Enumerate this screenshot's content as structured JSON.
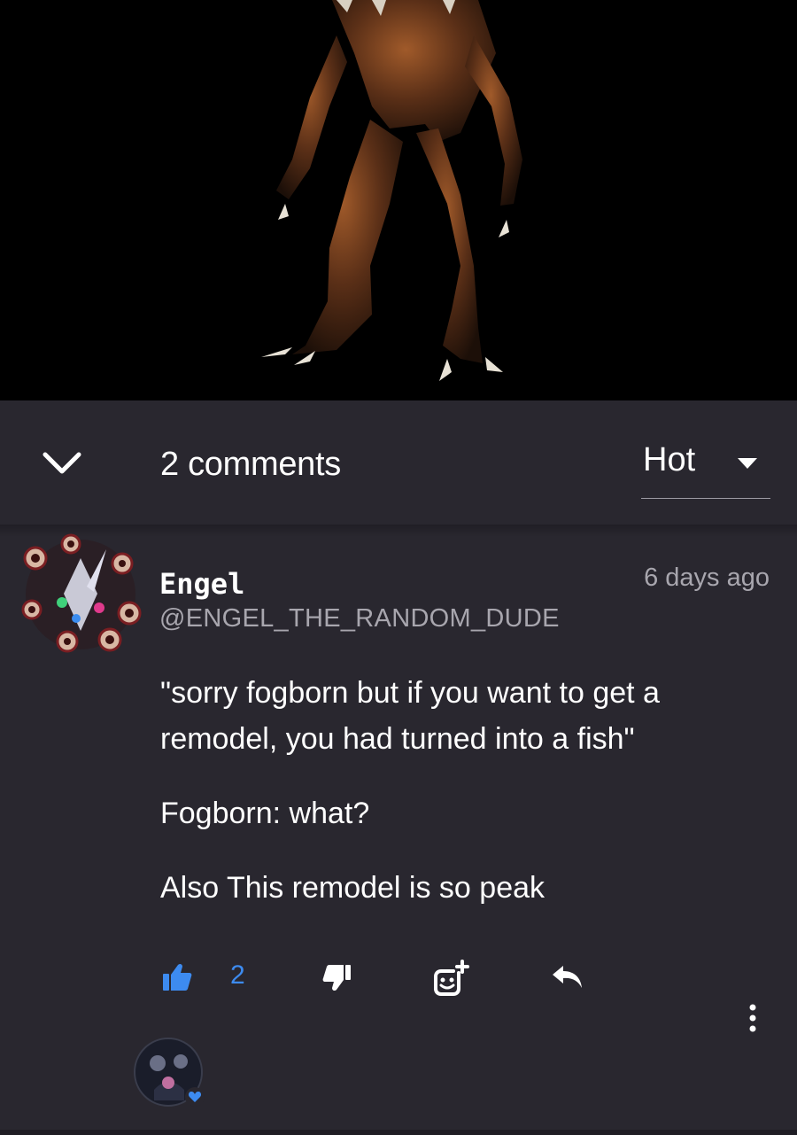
{
  "comments_header": {
    "count_label": "2 comments",
    "sort_value": "Hot"
  },
  "comment": {
    "author": "Engel",
    "handle": "@ENGEL_THE_RANDOM_DUDE",
    "time": "6 days ago",
    "paragraphs": [
      "\"sorry fogborn but if you want to get a remodel, you had turned into a fish\"",
      "Fogborn: what?",
      "Also This remodel is so peak"
    ],
    "like_count": "2"
  },
  "icons": {
    "collapse": "chevron-down-icon",
    "sort": "caret-down-icon",
    "like": "thumbs-up-icon",
    "dislike": "thumbs-down-icon",
    "react": "add-emoji-icon",
    "reply": "reply-icon",
    "more": "more-vertical-icon"
  },
  "colors": {
    "background": "#29272f",
    "accent": "#3d8bf0",
    "muted_text": "#a8a6ae"
  }
}
